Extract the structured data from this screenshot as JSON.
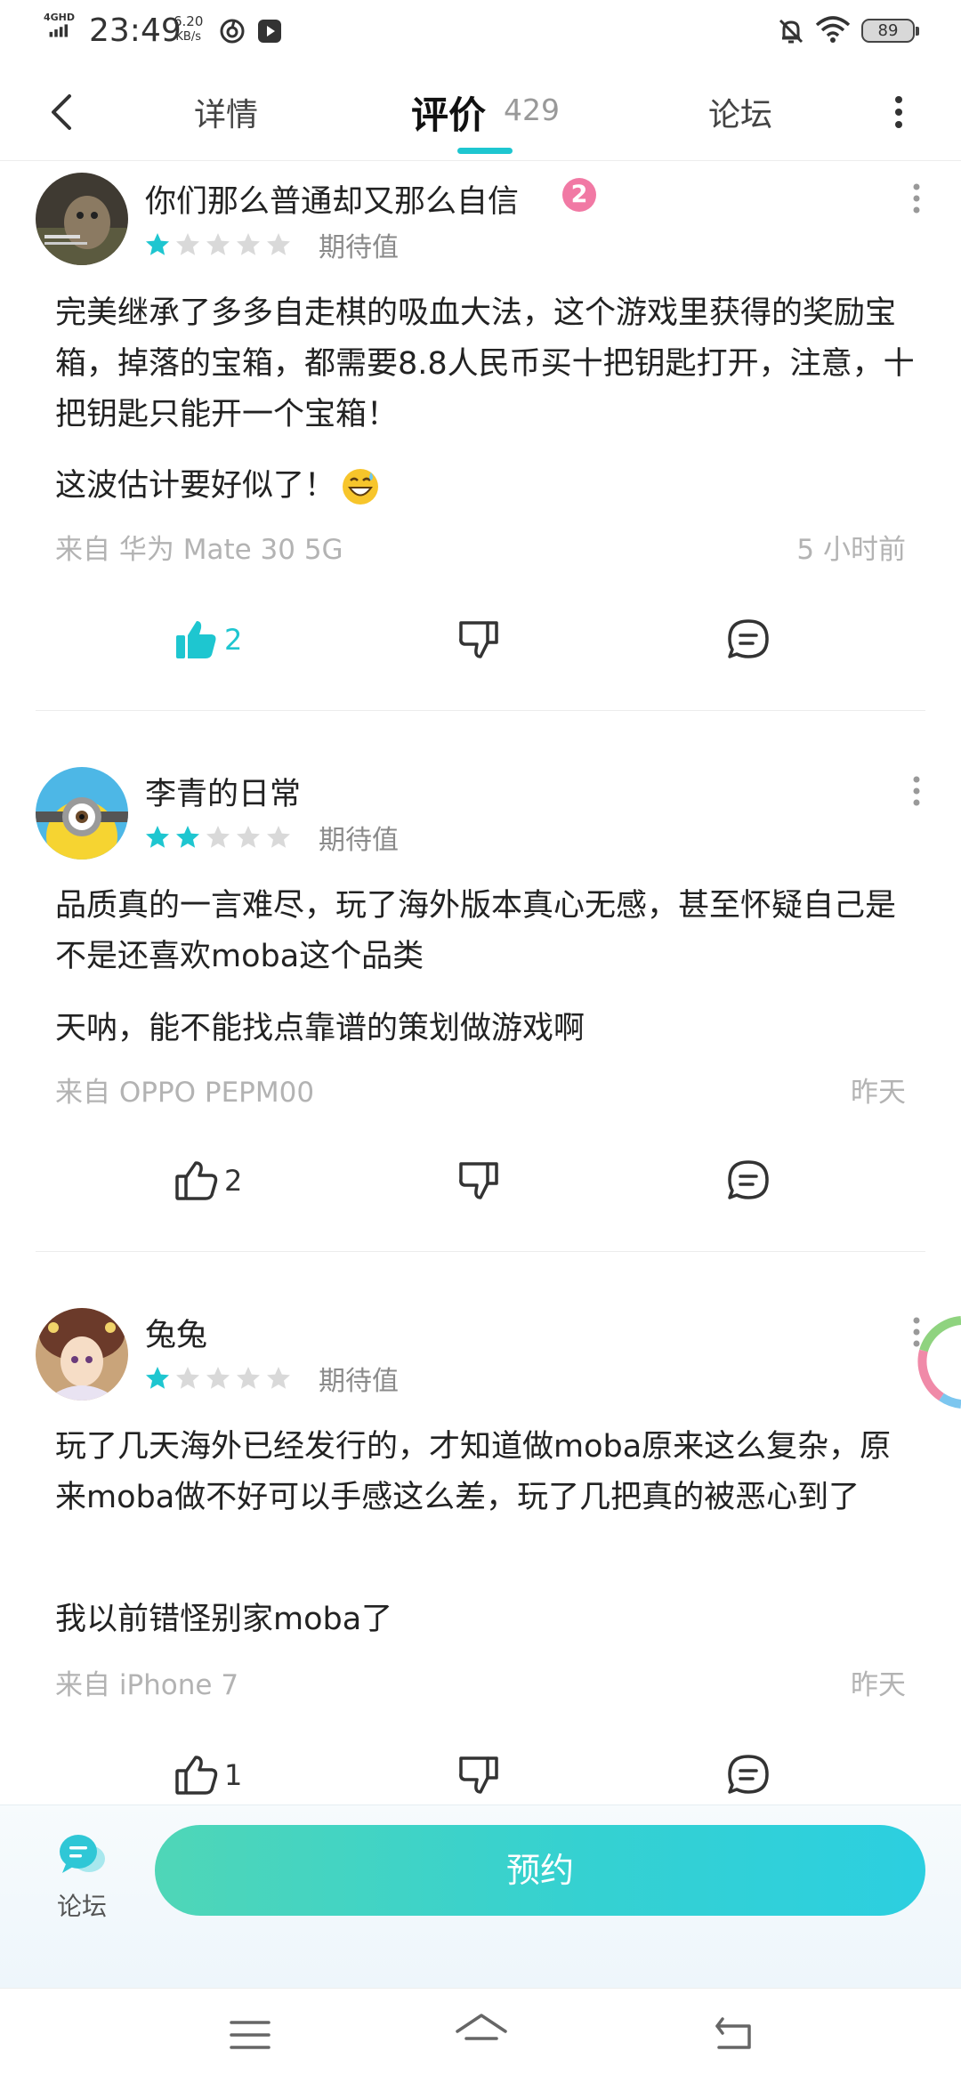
{
  "status_bar": {
    "network": "4GHD",
    "time": "23:49",
    "speed_value": "6.20",
    "speed_unit": "KB/s",
    "battery": "89"
  },
  "nav": {
    "tabs": [
      "详情",
      "评价",
      "论坛"
    ],
    "review_count": "429",
    "active_tab": "评价"
  },
  "colors": {
    "accent": "#1ec6d0",
    "star_on": "#1ec6d0",
    "star_off": "#d9d9d9",
    "badge": "#f179a4"
  },
  "reviews": [
    {
      "username": "你们那么普通却又那么自信",
      "level": "2",
      "rating": 1,
      "rating_label": "期待值",
      "paragraphs": [
        "完美继承了多多自走棋的吸血大法，这个游戏里获得的奖励宝箱，掉落的宝箱，都需要8.8人民币买十把钥匙打开，注意，十把钥匙只能开一个宝箱！",
        "这波估计要好似了！"
      ],
      "device": "来自 华为 Mate 30 5G",
      "time": "5 小时前",
      "likes": "2",
      "liked": true
    },
    {
      "username": "李青的日常",
      "rating": 2,
      "rating_label": "期待值",
      "paragraphs": [
        "品质真的一言难尽，玩了海外版本真心无感，甚至怀疑自己是不是还喜欢moba这个品类",
        "天呐，能不能找点靠谱的策划做游戏啊"
      ],
      "device": "来自 OPPO PEPM00",
      "time": "昨天",
      "likes": "2",
      "liked": false
    },
    {
      "username": "兔兔",
      "rating": 1,
      "rating_label": "期待值",
      "paragraphs": [
        "玩了几天海外已经发行的，才知道做moba原来这么复杂，原来moba做不好可以手感这么差，玩了几把真的被恶心到了",
        "我以前错怪别家moba了"
      ],
      "device": "来自 iPhone 7",
      "time": "昨天",
      "likes": "1",
      "liked": false
    }
  ],
  "bottom_bar": {
    "forum_label": "论坛",
    "reserve_label": "预约"
  }
}
